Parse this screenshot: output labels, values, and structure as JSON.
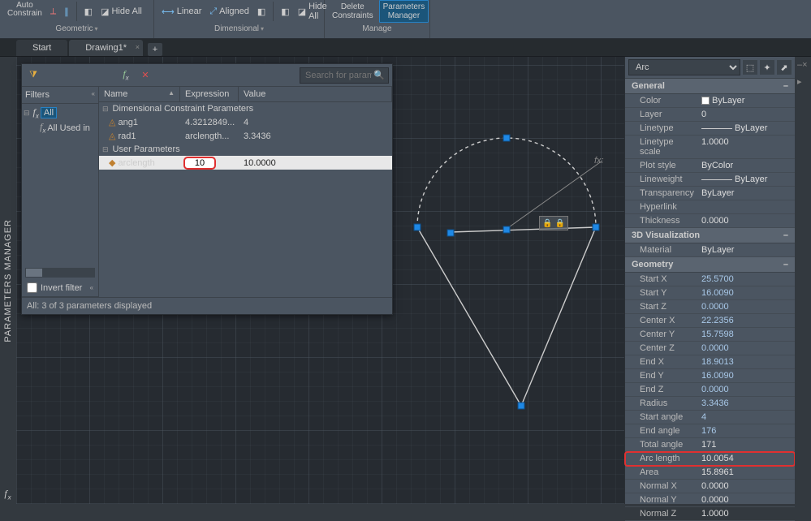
{
  "ribbon": {
    "geometric": {
      "auto_constrain": "Auto\nConstrain",
      "hide_all": "Hide All",
      "label": "Geometric"
    },
    "dimensional": {
      "linear": "Linear",
      "aligned": "Aligned",
      "hide_all": "Hide All",
      "label": "Dimensional"
    },
    "manage": {
      "delete_constraints": "Delete\nConstraints",
      "parameters_manager": "Parameters\nManager",
      "label": "Manage"
    }
  },
  "tabs": {
    "start": "Start",
    "drawing": "Drawing1*"
  },
  "pm": {
    "search_placeholder": "Search for parameter",
    "filters_label": "Filters",
    "filter_all": "All",
    "filter_used": "All Used in",
    "col_name": "Name",
    "col_expr": "Expression",
    "col_val": "Value",
    "group_dim": "Dimensional Constraint Parameters",
    "group_user": "User Parameters",
    "rows": [
      {
        "name": "ang1",
        "expr": "4.3212849...",
        "val": "4"
      },
      {
        "name": "rad1",
        "expr": "arclength...",
        "val": "3.3436"
      }
    ],
    "user_row": {
      "name": "arclength",
      "expr": "10",
      "val": "10.0000"
    },
    "invert_filter": "Invert filter",
    "status": "All: 3 of 3 parameters displayed"
  },
  "canvas": {
    "fx_label": "fx:"
  },
  "properties": {
    "selector": "Arc",
    "sections": {
      "general": "General",
      "viz3d": "3D Visualization",
      "geometry": "Geometry"
    },
    "general": [
      {
        "k": "Color",
        "v": "ByLayer",
        "swatch": true
      },
      {
        "k": "Layer",
        "v": "0"
      },
      {
        "k": "Linetype",
        "v": "ByLayer",
        "line": true
      },
      {
        "k": "Linetype scale",
        "v": "1.0000"
      },
      {
        "k": "Plot style",
        "v": "ByColor"
      },
      {
        "k": "Lineweight",
        "v": "ByLayer",
        "line": true
      },
      {
        "k": "Transparency",
        "v": "ByLayer"
      },
      {
        "k": "Hyperlink",
        "v": ""
      },
      {
        "k": "Thickness",
        "v": "0.0000"
      }
    ],
    "viz3d": [
      {
        "k": "Material",
        "v": "ByLayer"
      }
    ],
    "geometry": [
      {
        "k": "Start X",
        "v": "25.5700",
        "e": true
      },
      {
        "k": "Start Y",
        "v": "16.0090",
        "e": true
      },
      {
        "k": "Start Z",
        "v": "0.0000",
        "e": true
      },
      {
        "k": "Center X",
        "v": "22.2356",
        "e": true
      },
      {
        "k": "Center Y",
        "v": "15.7598",
        "e": true
      },
      {
        "k": "Center Z",
        "v": "0.0000",
        "e": true
      },
      {
        "k": "End X",
        "v": "18.9013",
        "e": true
      },
      {
        "k": "End Y",
        "v": "16.0090",
        "e": true
      },
      {
        "k": "End Z",
        "v": "0.0000",
        "e": true
      },
      {
        "k": "Radius",
        "v": "3.3436",
        "e": true
      },
      {
        "k": "Start angle",
        "v": "4",
        "e": true
      },
      {
        "k": "End angle",
        "v": "176",
        "e": true
      },
      {
        "k": "Total angle",
        "v": "171"
      },
      {
        "k": "Arc length",
        "v": "10.0054",
        "hl": true
      },
      {
        "k": "Area",
        "v": "15.8961"
      },
      {
        "k": "Normal X",
        "v": "0.0000"
      },
      {
        "k": "Normal Y",
        "v": "0.0000"
      },
      {
        "k": "Normal Z",
        "v": "1.0000"
      }
    ]
  },
  "sidebarLeft": "PARAMETERS MANAGER"
}
